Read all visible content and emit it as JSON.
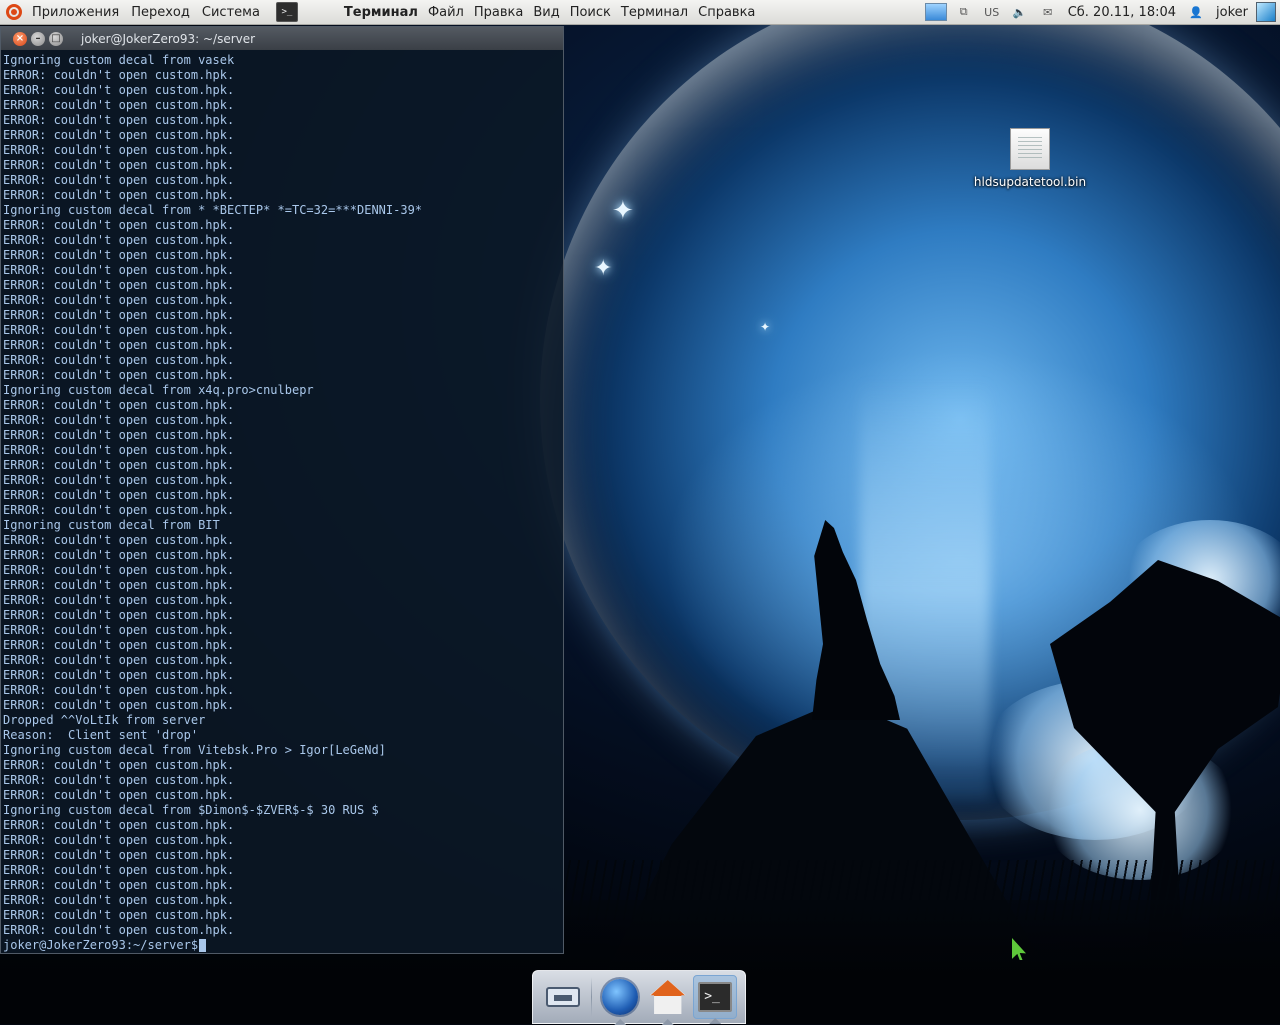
{
  "top_panel": {
    "menus": [
      "Приложения",
      "Переход",
      "Система"
    ],
    "app_menus": [
      "Терминал",
      "Файл",
      "Правка",
      "Вид",
      "Поиск",
      "Терминал",
      "Справка"
    ],
    "keyboard_layout": "US",
    "datetime": "Сб. 20.11, 18:04",
    "user": "joker"
  },
  "terminal": {
    "title": "joker@JokerZero93: ~/server",
    "lines": [
      "Ignoring custom decal from vasek",
      "ERROR: couldn't open custom.hpk.",
      "ERROR: couldn't open custom.hpk.",
      "ERROR: couldn't open custom.hpk.",
      "ERROR: couldn't open custom.hpk.",
      "ERROR: couldn't open custom.hpk.",
      "ERROR: couldn't open custom.hpk.",
      "ERROR: couldn't open custom.hpk.",
      "ERROR: couldn't open custom.hpk.",
      "ERROR: couldn't open custom.hpk.",
      "Ignoring custom decal from * *BECTEP* *=TC=32=***DENNI-39*",
      "ERROR: couldn't open custom.hpk.",
      "ERROR: couldn't open custom.hpk.",
      "ERROR: couldn't open custom.hpk.",
      "ERROR: couldn't open custom.hpk.",
      "ERROR: couldn't open custom.hpk.",
      "ERROR: couldn't open custom.hpk.",
      "ERROR: couldn't open custom.hpk.",
      "ERROR: couldn't open custom.hpk.",
      "ERROR: couldn't open custom.hpk.",
      "ERROR: couldn't open custom.hpk.",
      "ERROR: couldn't open custom.hpk.",
      "Ignoring custom decal from x4q.pro>cnulbepr",
      "ERROR: couldn't open custom.hpk.",
      "ERROR: couldn't open custom.hpk.",
      "ERROR: couldn't open custom.hpk.",
      "ERROR: couldn't open custom.hpk.",
      "ERROR: couldn't open custom.hpk.",
      "ERROR: couldn't open custom.hpk.",
      "ERROR: couldn't open custom.hpk.",
      "ERROR: couldn't open custom.hpk.",
      "Ignoring custom decal from BIT",
      "ERROR: couldn't open custom.hpk.",
      "ERROR: couldn't open custom.hpk.",
      "ERROR: couldn't open custom.hpk.",
      "ERROR: couldn't open custom.hpk.",
      "ERROR: couldn't open custom.hpk.",
      "ERROR: couldn't open custom.hpk.",
      "ERROR: couldn't open custom.hpk.",
      "ERROR: couldn't open custom.hpk.",
      "ERROR: couldn't open custom.hpk.",
      "ERROR: couldn't open custom.hpk.",
      "ERROR: couldn't open custom.hpk.",
      "ERROR: couldn't open custom.hpk.",
      "Dropped ^^VoLtIk from server",
      "Reason:  Client sent 'drop'",
      "Ignoring custom decal from Vitebsk.Pro > Igor[LeGeNd]",
      "ERROR: couldn't open custom.hpk.",
      "ERROR: couldn't open custom.hpk.",
      "ERROR: couldn't open custom.hpk.",
      "Ignoring custom decal from $Dimon$-$ZVER$-$ 30 RUS $",
      "ERROR: couldn't open custom.hpk.",
      "ERROR: couldn't open custom.hpk.",
      "ERROR: couldn't open custom.hpk.",
      "ERROR: couldn't open custom.hpk.",
      "ERROR: couldn't open custom.hpk.",
      "ERROR: couldn't open custom.hpk.",
      "ERROR: couldn't open custom.hpk.",
      "ERROR: couldn't open custom.hpk."
    ],
    "prompt": "joker@JokerZero93:~/server$"
  },
  "desktop": {
    "file_label": "hldsupdatetool.bin"
  },
  "dock": {
    "items": [
      {
        "name": "workspace-switcher",
        "icon": "workspace-icon"
      },
      {
        "name": "firefox",
        "icon": "firefox-icon"
      },
      {
        "name": "home-folder",
        "icon": "home-folder-icon"
      },
      {
        "name": "terminal",
        "icon": "terminal-icon"
      }
    ],
    "terminal_glyph": ">_"
  },
  "colors": {
    "terminal_text": "#a9c7ea",
    "close_button": "#d5461a",
    "pointer": "#5ec83a"
  }
}
